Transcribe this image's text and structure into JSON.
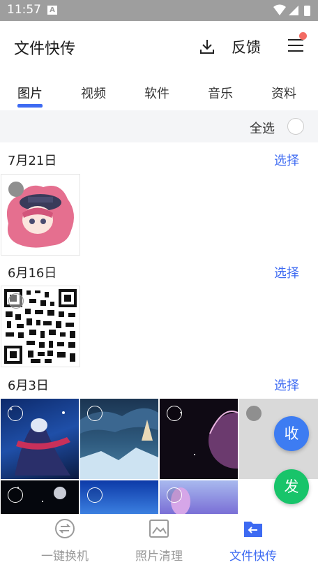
{
  "status": {
    "time": "11:57",
    "notify_badge": "A"
  },
  "header": {
    "title": "文件快传",
    "feedback": "反馈",
    "download_icon": "download-icon",
    "menu_icon": "menu-icon",
    "accent_dot": "#f36b63"
  },
  "tabs": [
    {
      "label": "图片",
      "active": true
    },
    {
      "label": "视频"
    },
    {
      "label": "软件"
    },
    {
      "label": "音乐"
    },
    {
      "label": "资料"
    }
  ],
  "select_all": {
    "label": "全选"
  },
  "sections": [
    {
      "date": "7月21日",
      "action": "选择"
    },
    {
      "date": "6月16日",
      "action": "选择"
    },
    {
      "date": "6月3日",
      "action": "选择"
    }
  ],
  "fab": {
    "receive": "收",
    "send": "发",
    "receive_color": "#3d7cf2",
    "send_color": "#18c46a"
  },
  "bottom_nav": [
    {
      "label": "一键换机",
      "icon": "swap-icon"
    },
    {
      "label": "照片清理",
      "icon": "photo-clean-icon"
    },
    {
      "label": "文件快传",
      "icon": "file-transfer-icon",
      "active": true
    }
  ],
  "colors": {
    "accent": "#3d6af2",
    "status_bar": "#9e9e9e"
  }
}
